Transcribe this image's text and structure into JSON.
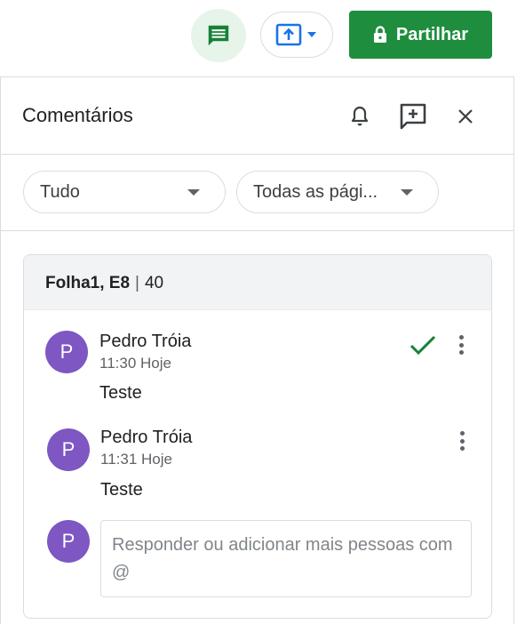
{
  "topbar": {
    "comments_icon": "comment-icon",
    "present_icon": "present-upload-icon",
    "share": {
      "icon": "lock-icon",
      "label": "Partilhar"
    }
  },
  "panel": {
    "title": "Comentários",
    "header_icons": [
      "bell-icon",
      "add-comment-icon",
      "close-icon"
    ],
    "filters": [
      {
        "label": "Tudo"
      },
      {
        "label": "Todas as pági..."
      }
    ]
  },
  "thread": {
    "cell": "Folha1, E8",
    "count": "40",
    "comments": [
      {
        "avatar": "P",
        "author": "Pedro Tróia",
        "time": "11:30 Hoje",
        "text": "Teste"
      },
      {
        "avatar": "P",
        "author": "Pedro Tróia",
        "time": "11:31 Hoje",
        "text": "Teste"
      }
    ],
    "reply": {
      "avatar": "P",
      "placeholder": "Responder ou adicionar mais pessoas com @"
    }
  },
  "colors": {
    "share_green": "#1e8e3e",
    "comment_toggle_bg": "#e6f4ea",
    "avatar_purple": "#7e57c2",
    "resolve_check": "#188038",
    "present_blue": "#1a73e8"
  }
}
